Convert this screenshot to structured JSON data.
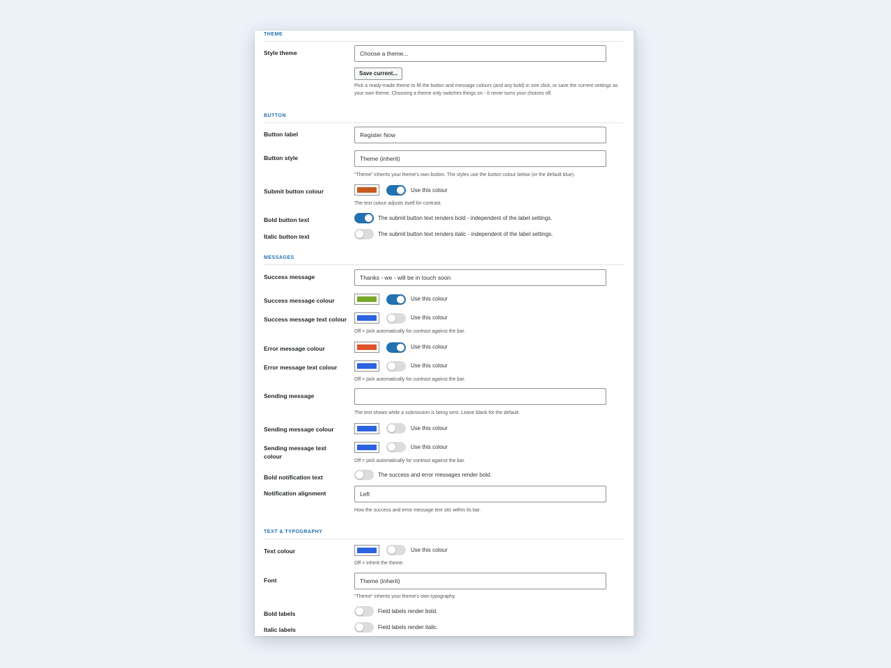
{
  "theme": {
    "heading": "THEME",
    "style_theme_label": "Style theme",
    "style_theme_value": "Choose a theme...",
    "save_current_label": "Save current...",
    "help": "Pick a ready-made theme to fill the button and message colours (and any bold) in one click, or save the current settings as your own theme. Choosing a theme only switches things on - it never turns your choices off."
  },
  "button": {
    "heading": "BUTTON",
    "label_label": "Button label",
    "label_value": "Register Now",
    "style_label": "Button style",
    "style_value": "Theme (inherit)",
    "style_help": "\"Theme\" inherits your theme's own button. The styles use the button colour below (or the default blue).",
    "colour_label": "Submit button colour",
    "colour_swatch": "#c55a1e",
    "colour_toggle_on": true,
    "colour_toggle_text": "Use this colour",
    "colour_help": "The text colour adjusts itself for contrast.",
    "bold_label": "Bold button text",
    "bold_on": true,
    "bold_text": "The submit button text renders bold - independent of the label settings.",
    "italic_label": "Italic button text",
    "italic_on": false,
    "italic_text": "The submit button text renders italic - independent of the label settings."
  },
  "messages": {
    "heading": "MESSAGES",
    "success_label": "Success message",
    "success_value": "Thanks - we - will be in touch soon",
    "success_colour_label": "Success message colour",
    "success_colour_swatch": "#7aa72c",
    "success_colour_on": true,
    "success_text_colour_label": "Success message text colour",
    "success_text_colour_swatch": "#2b63e0",
    "success_text_colour_on": false,
    "use_colour_text": "Use this colour",
    "auto_help": "Off = pick automatically for contrast against the bar.",
    "error_colour_label": "Error message colour",
    "error_colour_swatch": "#e0522b",
    "error_colour_on": true,
    "error_text_colour_label": "Error message text colour",
    "error_text_colour_swatch": "#2b63e0",
    "error_text_colour_on": false,
    "sending_label": "Sending message",
    "sending_value": "",
    "sending_help": "The text shown while a submission is being sent. Leave blank for the default.",
    "sending_colour_label": "Sending message colour",
    "sending_colour_swatch": "#2b63e0",
    "sending_colour_on": false,
    "sending_text_colour_label": "Sending message text colour",
    "sending_text_colour_swatch": "#2b63e0",
    "sending_text_colour_on": false,
    "bold_notif_label": "Bold notification text",
    "bold_notif_on": false,
    "bold_notif_text": "The success and error messages render bold.",
    "alignment_label": "Notification alignment",
    "alignment_value": "Left",
    "alignment_help": "How the success and error message text sits within its bar."
  },
  "typography": {
    "heading": "TEXT & TYPOGRAPHY",
    "text_colour_label": "Text colour",
    "text_colour_swatch": "#2b63e0",
    "text_colour_on": false,
    "text_colour_toggle_text": "Use this colour",
    "text_colour_help": "Off = inherit the theme.",
    "font_label": "Font",
    "font_value": "Theme (inherit)",
    "font_help": "\"Theme\" inherits your theme's own typography.",
    "bold_labels_label": "Bold labels",
    "bold_labels_on": false,
    "bold_labels_text": "Field labels render bold.",
    "italic_labels_label": "Italic labels",
    "italic_labels_on": false,
    "italic_labels_text": "Field labels render italic."
  }
}
